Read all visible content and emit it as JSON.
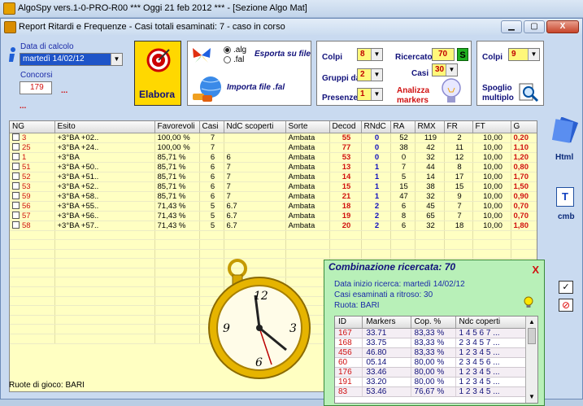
{
  "outer": {
    "title": "AlgoSpy vers.1-0-PRO-R00   ***   Oggi 21 feb 2012   ***   - [Sezione Algo Mat]"
  },
  "window": {
    "title": "Report Ritardi e Frequenze - Casi totali esaminati: 7 - caso in corso",
    "minimize": "▁",
    "maximize": "▢",
    "close": "X"
  },
  "left": {
    "data_label": "Data di calcolo",
    "date_value": "martedì 14/02/12",
    "concorsi_label": "Concorsi",
    "concorsi_value": "179",
    "dots": "...",
    "dots2": "..."
  },
  "elabora": {
    "label": "Elabora"
  },
  "esporta": {
    "opt_alg": ".alg",
    "opt_fal": ".fal",
    "label": "Esporta su file",
    "import_label": "Importa file .fal"
  },
  "params": {
    "colpi_label": "Colpi",
    "colpi_value": "8",
    "gruppi_label": "Gruppi da",
    "gruppi_value": "2",
    "presenze_label": "Presenze",
    "presenze_value": "1",
    "ricercato_label": "Ricercato",
    "ricercato_value": "70",
    "s_label": "S",
    "casi_label": "Casi",
    "casi_value": "30",
    "analizza_label": "Analizza markers"
  },
  "spoglio": {
    "colpi_label": "Colpi",
    "colpi_value": "9",
    "label": "Spoglio multiplo"
  },
  "side": {
    "html_label": "Html",
    "cmb_label": "cmb",
    "check_mark": "✓",
    "forbid": "⊘"
  },
  "grid": {
    "headers": [
      "NG",
      "Esito",
      "Favorevoli",
      "Casi",
      "NdC scoperti",
      "Sorte",
      "Decod",
      "RNdC",
      "RA",
      "RMX",
      "FR",
      "FT",
      "G"
    ],
    "rows": [
      [
        "3",
        "+3°BA +02..",
        "100,00 %",
        "7",
        "",
        "Ambata",
        "55",
        "0",
        "52",
        "119",
        "2",
        "10,00",
        "0,20"
      ],
      [
        "25",
        "+3°BA +24..",
        "100,00 %",
        "7",
        "",
        "Ambata",
        "77",
        "0",
        "38",
        "42",
        "11",
        "10,00",
        "1,10"
      ],
      [
        "1",
        "+3°BA",
        "85,71 %",
        "6",
        "6",
        "Ambata",
        "53",
        "0",
        "0",
        "32",
        "12",
        "10,00",
        "1,20"
      ],
      [
        "51",
        "+3°BA +50..",
        "85,71 %",
        "6",
        "7",
        "Ambata",
        "13",
        "1",
        "7",
        "44",
        "8",
        "10,00",
        "0,80"
      ],
      [
        "52",
        "+3°BA +51..",
        "85,71 %",
        "6",
        "7",
        "Ambata",
        "14",
        "1",
        "5",
        "14",
        "17",
        "10,00",
        "1,70"
      ],
      [
        "53",
        "+3°BA +52..",
        "85,71 %",
        "6",
        "7",
        "Ambata",
        "15",
        "1",
        "15",
        "38",
        "15",
        "10,00",
        "1,50"
      ],
      [
        "59",
        "+3°BA +58..",
        "85,71 %",
        "6",
        "7",
        "Ambata",
        "21",
        "1",
        "47",
        "32",
        "9",
        "10,00",
        "0,90"
      ],
      [
        "56",
        "+3°BA +55..",
        "71,43 %",
        "5",
        "6.7",
        "Ambata",
        "18",
        "2",
        "6",
        "45",
        "7",
        "10,00",
        "0,70"
      ],
      [
        "57",
        "+3°BA +56..",
        "71,43 %",
        "5",
        "6.7",
        "Ambata",
        "19",
        "2",
        "8",
        "65",
        "7",
        "10,00",
        "0,70"
      ],
      [
        "58",
        "+3°BA +57..",
        "71,43 %",
        "5",
        "6.7",
        "Ambata",
        "20",
        "2",
        "6",
        "32",
        "18",
        "10,00",
        "1,80"
      ]
    ]
  },
  "status": {
    "text": "Ruote di gioco: BARI"
  },
  "popup": {
    "title": "Combinazione ricercata: 70",
    "close": "X",
    "line1": "Data inizio ricerca: martedì 14/02/12",
    "line2": "Casi esaminati a ritroso: 30",
    "line3": "Ruota: BARI",
    "headers": [
      "ID",
      "Markers",
      "Cop. %",
      "Ndc coperti"
    ],
    "rows": [
      [
        "167",
        "33.71",
        "83,33 %",
        "1 4 5 6 7 ..."
      ],
      [
        "168",
        "33.75",
        "83,33 %",
        "2 3 4 5 7 ..."
      ],
      [
        "456",
        "46.80",
        "83,33 %",
        "1 2 3 4 5 ..."
      ],
      [
        "60",
        "05.14",
        "80,00 %",
        "2 3 4 5 6 ..."
      ],
      [
        "176",
        "33.46",
        "80,00 %",
        "1 2 3 4 5 ..."
      ],
      [
        "191",
        "33.20",
        "80,00 %",
        "1 2 3 4 5 ..."
      ],
      [
        "83",
        "53.46",
        "76,67 %",
        "1 2 3 4 5 ..."
      ]
    ]
  }
}
